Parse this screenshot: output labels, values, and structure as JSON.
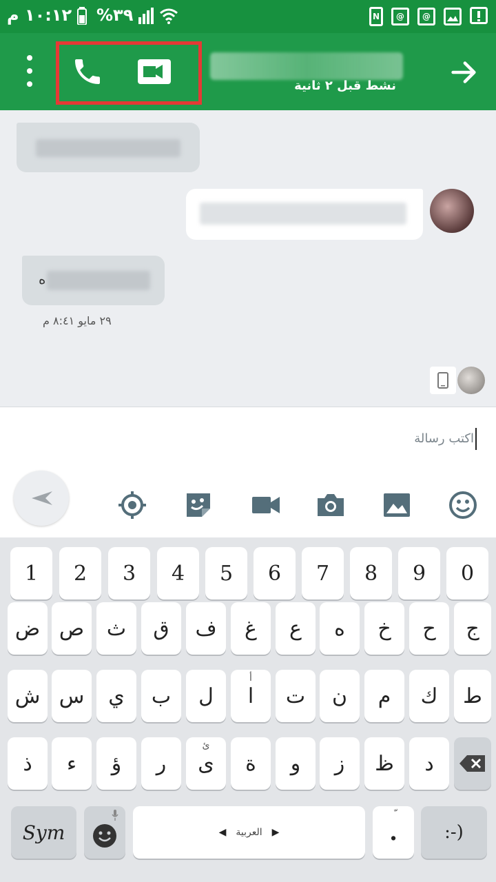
{
  "status_bar": {
    "time": "١٠:١٢ م",
    "battery": "%٣٩",
    "notif_label": "@"
  },
  "header": {
    "contact_status": "نشط قبل ٢ ثانية"
  },
  "chat": {
    "message_timestamp": "٢٩ مايو ٨:٤١ م",
    "msg_fragment": "ه"
  },
  "compose": {
    "placeholder": "اكتب رسالة"
  },
  "keyboard": {
    "row1": [
      "1",
      "2",
      "3",
      "4",
      "5",
      "6",
      "7",
      "8",
      "9",
      "0"
    ],
    "row2": [
      "ض",
      "ص",
      "ث",
      "ق",
      "ف",
      "غ",
      "ع",
      "ه",
      "خ",
      "ح",
      "ج"
    ],
    "row3": [
      "ش",
      "س",
      "ي",
      "ب",
      "ل",
      "ا",
      "ت",
      "ن",
      "م",
      "ك",
      "ط"
    ],
    "row3_sub": "أ",
    "row4": [
      "ذ",
      "ء",
      "ؤ",
      "ر",
      "ى",
      "ة",
      "و",
      "ز",
      "ظ",
      "د"
    ],
    "row4_sub": "ئ",
    "sym_label": "Sym",
    "space_label": "العربية",
    "period_label": ".",
    "period_sub": "ّ",
    "smiley_label": ":-)"
  },
  "colors": {
    "status_bar": "#17913f",
    "app_bar": "#1f9a4a",
    "highlight": "#e53935",
    "icon_gray": "#546e7a"
  }
}
